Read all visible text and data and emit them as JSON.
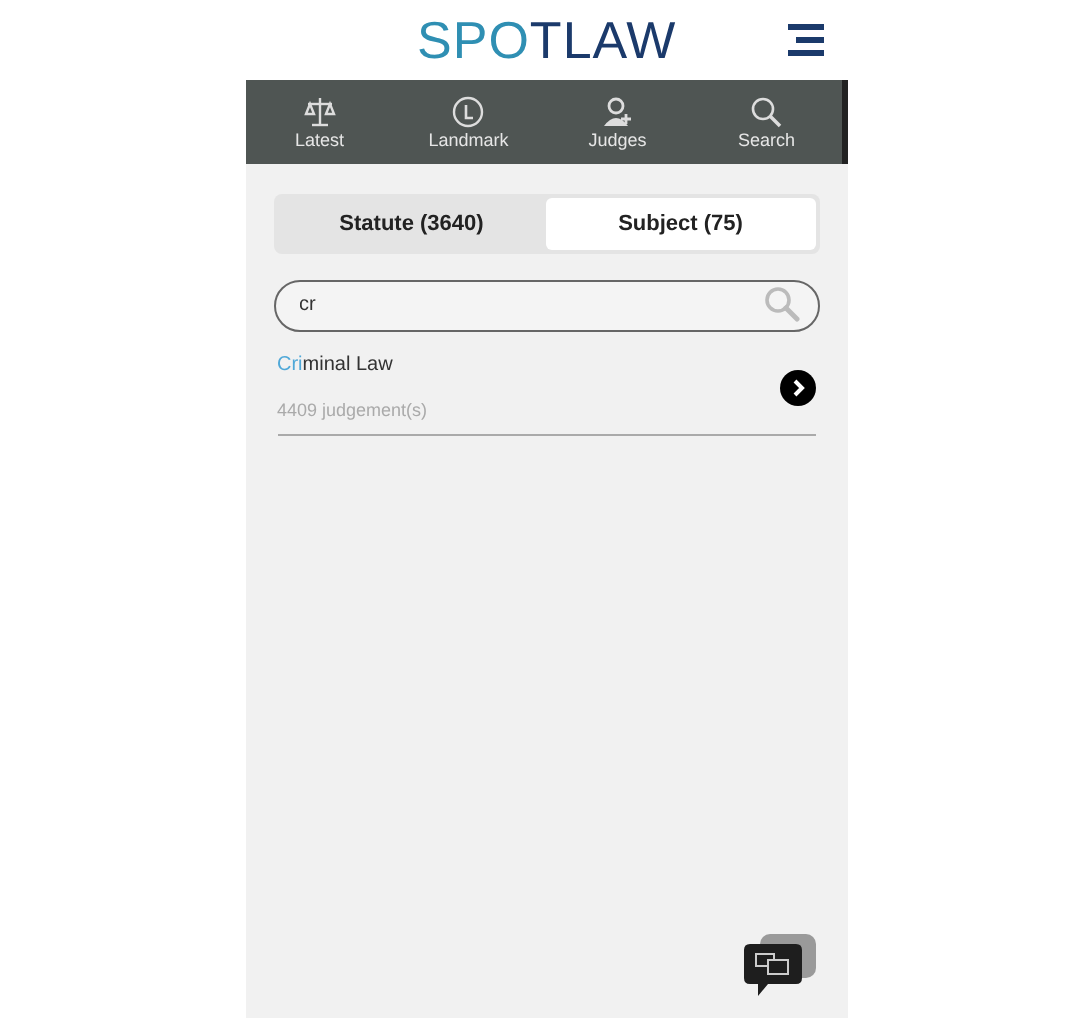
{
  "header": {
    "logo": "SPOTLAW"
  },
  "nav": [
    {
      "label": "Latest",
      "kind": "scales",
      "selected": false
    },
    {
      "label": "Landmark",
      "kind": "landmark",
      "selected": false
    },
    {
      "label": "Judges",
      "kind": "judge",
      "selected": false
    },
    {
      "label": "Search",
      "kind": "search",
      "selected": false
    }
  ],
  "tabs": [
    {
      "label": "Statute (3640)",
      "selected": false
    },
    {
      "label": "Subject (75)",
      "selected": true
    }
  ],
  "search": {
    "value": "cr"
  },
  "results": [
    {
      "title_match": "Cri",
      "title_rest": "minal Law",
      "count": "4409 judgement(s)"
    }
  ]
}
